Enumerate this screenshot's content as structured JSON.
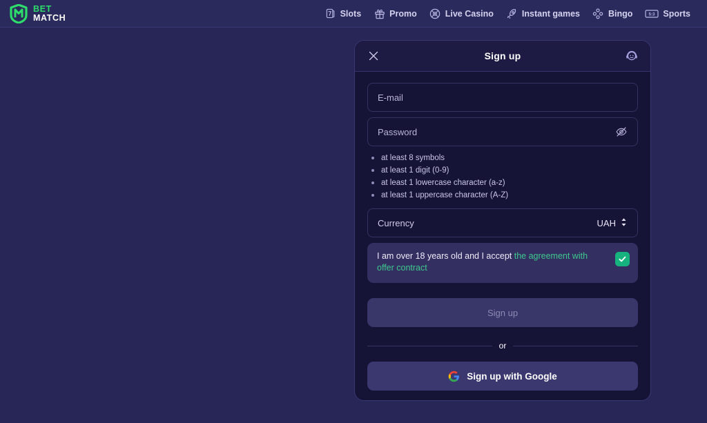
{
  "header": {
    "logo": {
      "icon": "shield-m-logo-icon",
      "line1": "BET",
      "line2": "MATCH",
      "brand_color": "#2ddc6a"
    },
    "nav": [
      {
        "label": "Slots",
        "icon": "slot-card-seven-icon"
      },
      {
        "label": "Promo",
        "icon": "gift-box-icon"
      },
      {
        "label": "Live Casino",
        "icon": "roulette-wheel-icon"
      },
      {
        "label": "Instant games",
        "icon": "rocket-icon"
      },
      {
        "label": "Bingo",
        "icon": "bingo-balls-icon"
      },
      {
        "label": "Sports",
        "icon": "scoreboard-icon"
      }
    ],
    "sports_score": "5:3"
  },
  "modal": {
    "title": "Sign up",
    "close_icon": "close-icon",
    "support_icon": "support-headset-icon",
    "email": {
      "placeholder": "E-mail",
      "value": ""
    },
    "password": {
      "placeholder": "Password",
      "value": "",
      "toggle_icon": "eye-off-icon"
    },
    "password_rules": [
      "at least 8 symbols",
      "at least 1 digit (0-9)",
      "at least 1 lowercase character (a-z)",
      "at least 1 uppercase character (A-Z)"
    ],
    "currency": {
      "label": "Currency",
      "value": "UAH",
      "chevron_icon": "chevron-updown-icon"
    },
    "agreement": {
      "text_before": "I am over 18 years old and I accept ",
      "link_text": "the agreement with offer contract",
      "checked": true,
      "check_color": "#17b37f",
      "link_color": "#3ec98e"
    },
    "submit": {
      "label": "Sign up",
      "disabled": true
    },
    "divider_label": "or",
    "google": {
      "label": "Sign up with Google",
      "icon": "google-g-icon"
    }
  },
  "colors": {
    "page_bg": "#272656",
    "header_bg": "#2b2a5c",
    "modal_bg": "#161436",
    "modal_header_bg": "#1d1b44",
    "accent_green": "#2ddc6a",
    "teal": "#17b37f"
  }
}
